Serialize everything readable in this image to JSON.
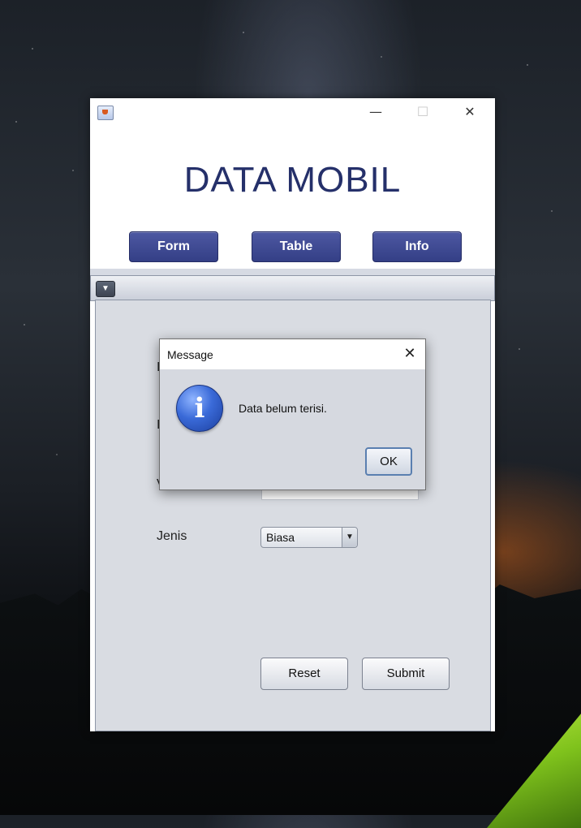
{
  "window": {
    "title_bar": {
      "minimize": "—",
      "maximize": "☐",
      "close": "✕"
    },
    "app_title": "DATA MOBIL"
  },
  "nav": {
    "form_label": "Form",
    "table_label": "Table",
    "info_label": "Info"
  },
  "internal_frame": {
    "toggle_glyph": "▼"
  },
  "form": {
    "jenis_label": "Jenis",
    "jenis_value": "Biasa",
    "combo_arrow": "▼",
    "partial_labels": [
      "I",
      "I",
      "V"
    ],
    "reset_label": "Reset",
    "submit_label": "Submit"
  },
  "dialog": {
    "title": "Message",
    "close": "✕",
    "icon_glyph": "i",
    "message": "Data belum terisi.",
    "ok_label": "OK"
  },
  "colors": {
    "title_color": "#25306a",
    "nav_button": "#3f4a93",
    "panel_bg": "#d9dce2"
  }
}
